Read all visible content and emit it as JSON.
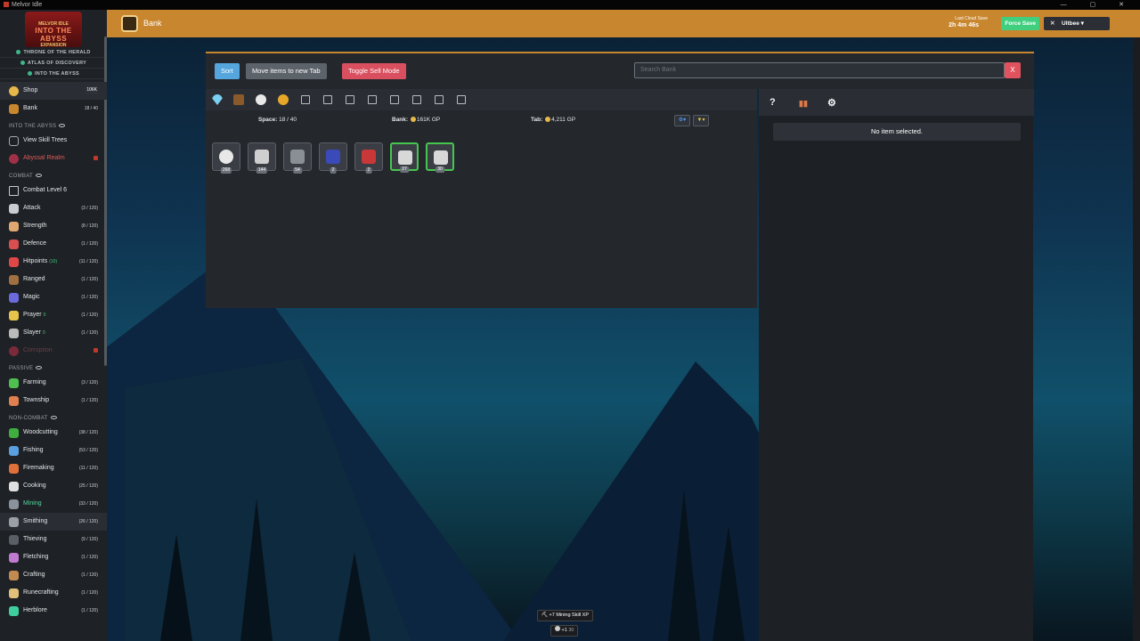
{
  "window": {
    "title": "Melvor Idle",
    "controls": "— ▢ ✕"
  },
  "sidebar": {
    "logo": {
      "line1": "MELVOR IDLE",
      "line2": "INTO THE ABYSS",
      "line3": "EXPANSION"
    },
    "expansions": [
      "THRONE OF THE HERALD",
      "ATLAS OF DISCOVERY",
      "INTO THE ABYSS"
    ],
    "shop": {
      "label": "Shop",
      "badge": "106K"
    },
    "bank": {
      "label": "Bank",
      "meta": "18 / 40"
    },
    "section_abyss": "INTO THE ABYSS",
    "skill_trees": "View Skill Trees",
    "abyssal_realm": "Abyssal Realm",
    "section_combat": "COMBAT",
    "combat_level": "Combat Level 6",
    "combat_skills": [
      {
        "label": "Attack",
        "meta": "(3 / 120)",
        "color": "#c9ccd1"
      },
      {
        "label": "Strength",
        "meta": "(8 / 120)",
        "color": "#e0a870"
      },
      {
        "label": "Defence",
        "meta": "(1 / 120)",
        "color": "#d94f4f"
      },
      {
        "label": "Hitpoints",
        "extra": "(10)",
        "meta": "(11 / 120)",
        "color": "#e04848"
      },
      {
        "label": "Ranged",
        "meta": "(1 / 120)",
        "color": "#a07040"
      },
      {
        "label": "Magic",
        "meta": "(1 / 120)",
        "color": "#6a6adc"
      },
      {
        "label": "Prayer",
        "extra": "0",
        "meta": "(1 / 120)",
        "color": "#e7c54a"
      },
      {
        "label": "Slayer",
        "extra": "0",
        "meta": "(1 / 120)",
        "color": "#bbbbbb"
      }
    ],
    "corruption": "Corruption",
    "section_passive": "PASSIVE",
    "passive_skills": [
      {
        "label": "Farming",
        "meta": "(3 / 120)",
        "color": "#4fbf4f"
      },
      {
        "label": "Township",
        "meta": "(1 / 120)",
        "color": "#e08050"
      }
    ],
    "section_noncombat": "NON-COMBAT",
    "noncombat_skills": [
      {
        "label": "Woodcutting",
        "meta": "(38 / 120)",
        "color": "#3fae3f"
      },
      {
        "label": "Fishing",
        "meta": "(53 / 120)",
        "color": "#5aa0e0"
      },
      {
        "label": "Firemaking",
        "meta": "(11 / 120)",
        "color": "#e0703a"
      },
      {
        "label": "Cooking",
        "meta": "(25 / 120)",
        "color": "#e0e0e0"
      },
      {
        "label": "Mining",
        "meta": "(33 / 120)",
        "color": "#8a939c"
      },
      {
        "label": "Smithing",
        "meta": "(26 / 120)",
        "color": "#9aa0a6"
      },
      {
        "label": "Thieving",
        "meta": "(9 / 120)",
        "color": "#5a5f66"
      },
      {
        "label": "Fletching",
        "meta": "(1 / 120)",
        "color": "#c07ad0"
      },
      {
        "label": "Crafting",
        "meta": "(1 / 120)",
        "color": "#c08a50"
      },
      {
        "label": "Runecrafting",
        "meta": "(1 / 120)",
        "color": "#e0c07a"
      },
      {
        "label": "Herblore",
        "meta": "(1 / 120)",
        "color": "#3fcf9f"
      }
    ]
  },
  "header": {
    "title": "Bank",
    "last_save_label": "Last Cloud Save",
    "last_save_time": "2h 4m 46s",
    "force_save": "Force Save",
    "account": "Ultbee"
  },
  "bank": {
    "sort": "Sort",
    "move": "Move items to new Tab",
    "toggle_sell": "Toggle Sell Mode",
    "search_placeholder": "Search Bank",
    "search_close": "X",
    "space_label": "Space:",
    "space_value": "18 / 40",
    "bank_label": "Bank:",
    "bank_value": "161K GP",
    "tab_label": "Tab:",
    "tab_value": "4,211 GP",
    "items": [
      {
        "qty": "268",
        "color": "#e8e8e8",
        "green": false
      },
      {
        "qty": "144",
        "color": "#cfcfcf",
        "green": false
      },
      {
        "qty": "54",
        "color": "#8a8f96",
        "green": false
      },
      {
        "qty": "2",
        "color": "#3a4ab8",
        "green": false
      },
      {
        "qty": "2",
        "color": "#c83838",
        "green": false
      },
      {
        "qty": "27",
        "color": "#d8d8d8",
        "green": true
      },
      {
        "qty": "30",
        "color": "#d8d8d8",
        "green": true
      }
    ],
    "no_item": "No item selected."
  },
  "notifications": {
    "xp": "+7",
    "xp_label": "Mining Skill XP",
    "item": "+1",
    "item_count": "30"
  }
}
